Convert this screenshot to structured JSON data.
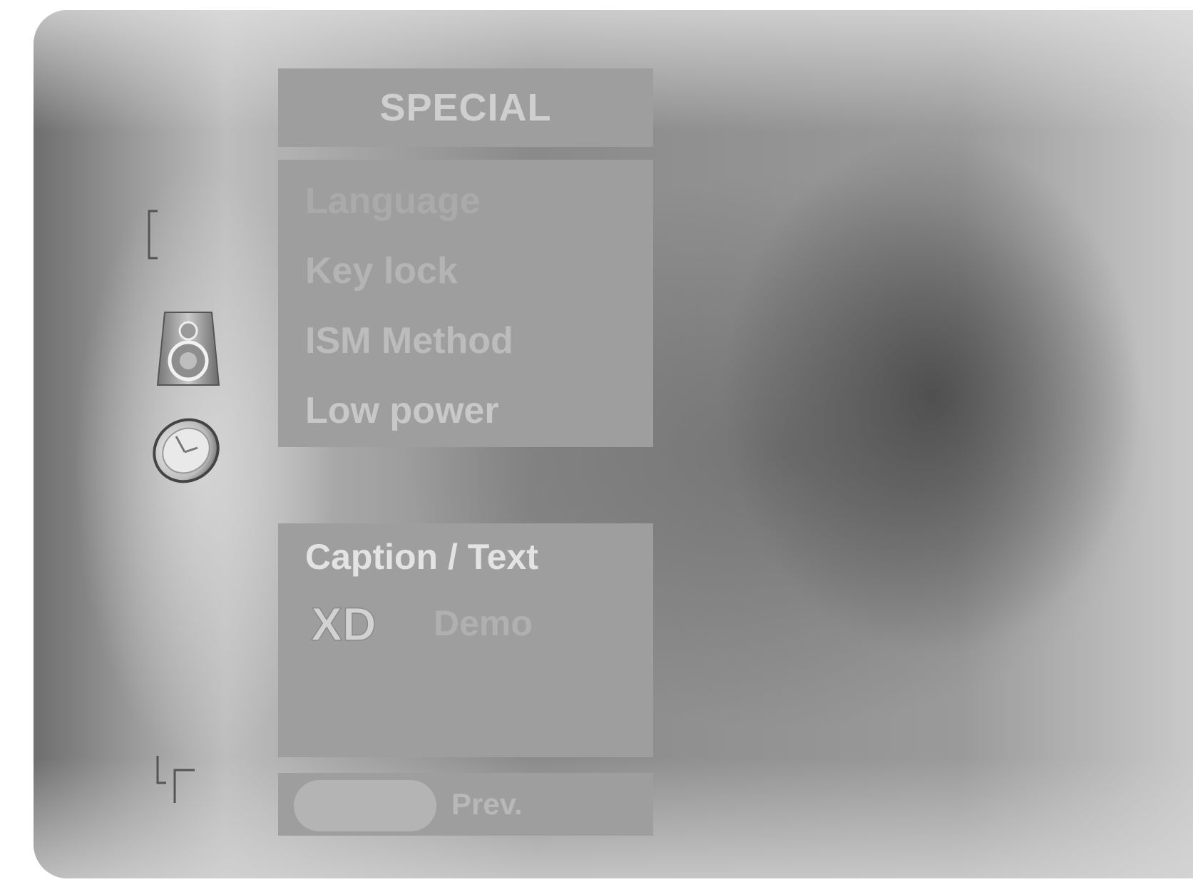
{
  "menu": {
    "title": "SPECIAL",
    "items": [
      {
        "label": "Language"
      },
      {
        "label": "Key lock"
      },
      {
        "label": "ISM Method"
      },
      {
        "label": "Low power"
      }
    ],
    "extras": {
      "caption": "Caption / Text",
      "xd_logo": "XD",
      "xd_demo": "Demo"
    },
    "footer": {
      "prev": "Prev."
    }
  },
  "side_icons": [
    "bracket-icon",
    "speaker-icon",
    "clock-icon",
    "corner-bracket-icon"
  ],
  "colors": {
    "panel": "#9e9e9e",
    "highlight_text": "#e3e3e3",
    "dim_text": "#b0b0b0"
  }
}
